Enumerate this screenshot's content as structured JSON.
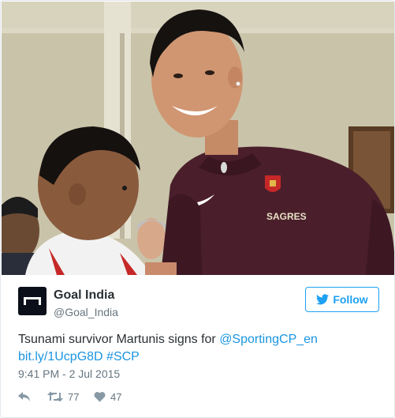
{
  "tweet": {
    "author": {
      "name": "Goal India",
      "handle": "@Goal_India"
    },
    "follow_label": "Follow",
    "text_parts": {
      "plain": "Tsunami survivor Martunis signs for ",
      "mention": "@SportingCP_en",
      "url": "bit.ly/1UcpG8D",
      "hashtag": "#SCP"
    },
    "timestamp": "9:41 PM - 2 Jul 2015",
    "stats": {
      "retweets": "77",
      "likes": "47"
    }
  },
  "photo": {
    "shirt_sponsor": "SAGRES"
  },
  "colors": {
    "twitter_blue": "#1da1f2",
    "link_blue": "#1b95e0",
    "secondary_text": "#66757f",
    "shirt_maroon": "#4a1f2b"
  },
  "icons": {
    "follow": "bird-icon",
    "reply": "reply-icon",
    "retweet": "retweet-icon",
    "like": "heart-icon"
  }
}
